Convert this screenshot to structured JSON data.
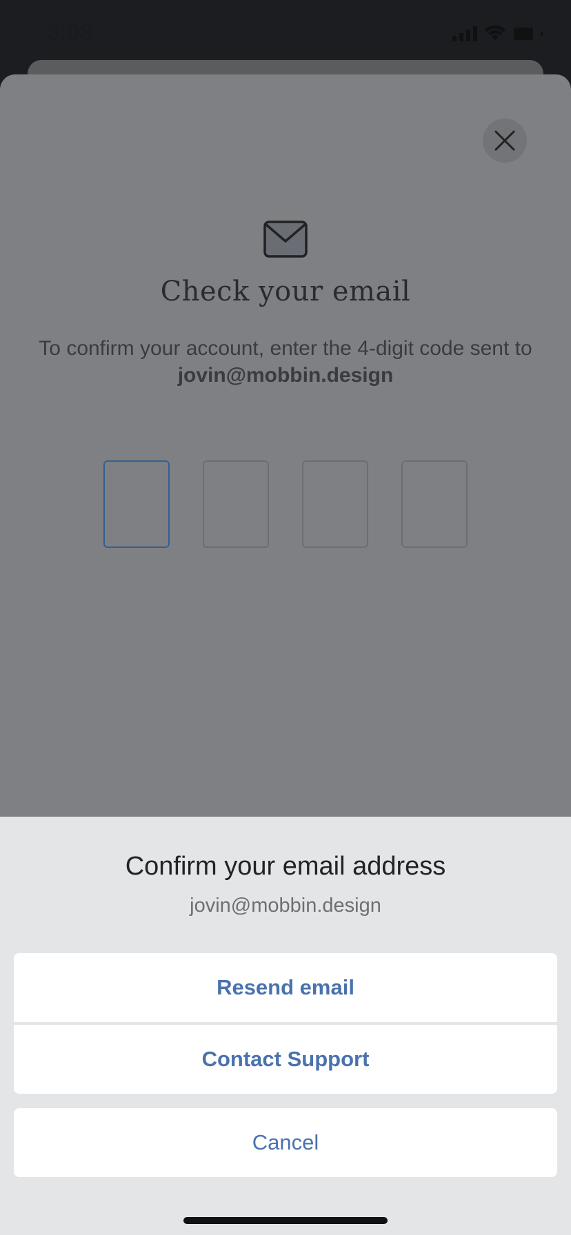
{
  "status_bar": {
    "time": "3:08"
  },
  "sheet": {
    "title": "Check your email",
    "subtitle": "To confirm your account, enter the 4-digit code sent to",
    "email": "jovin@mobbin.design",
    "code_length": 4
  },
  "action_sheet": {
    "title": "Confirm your email address",
    "email": "jovin@mobbin.design",
    "resend_label": "Resend email",
    "support_label": "Contact Support",
    "cancel_label": "Cancel"
  },
  "colors": {
    "accent": "#4a72ad",
    "active_code_border": "#35608f"
  },
  "icons": {
    "close": "close-icon",
    "mail": "mail-icon",
    "signal": "signal-icon",
    "wifi": "wifi-icon",
    "battery": "battery-icon"
  }
}
